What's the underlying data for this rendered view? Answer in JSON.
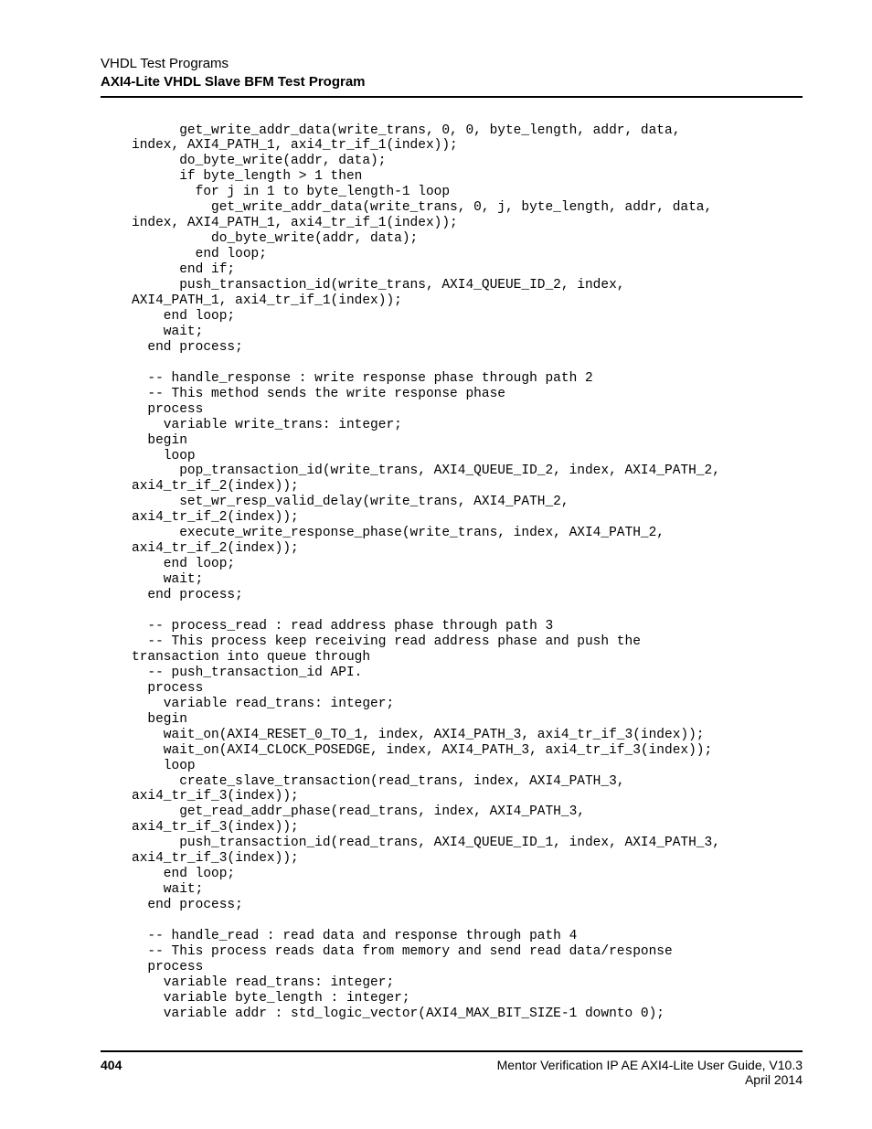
{
  "header": {
    "line1": "VHDL Test Programs",
    "line2": "AXI4-Lite VHDL Slave BFM Test Program"
  },
  "code": "      get_write_addr_data(write_trans, 0, 0, byte_length, addr, data,\nindex, AXI4_PATH_1, axi4_tr_if_1(index));\n      do_byte_write(addr, data);\n      if byte_length > 1 then\n        for j in 1 to byte_length-1 loop\n          get_write_addr_data(write_trans, 0, j, byte_length, addr, data,\nindex, AXI4_PATH_1, axi4_tr_if_1(index));\n          do_byte_write(addr, data);\n        end loop;\n      end if;\n      push_transaction_id(write_trans, AXI4_QUEUE_ID_2, index,\nAXI4_PATH_1, axi4_tr_if_1(index));\n    end loop;\n    wait;\n  end process;\n\n  -- handle_response : write response phase through path 2\n  -- This method sends the write response phase\n  process\n    variable write_trans: integer;\n  begin\n    loop\n      pop_transaction_id(write_trans, AXI4_QUEUE_ID_2, index, AXI4_PATH_2,\naxi4_tr_if_2(index));\n      set_wr_resp_valid_delay(write_trans, AXI4_PATH_2,\naxi4_tr_if_2(index));\n      execute_write_response_phase(write_trans, index, AXI4_PATH_2,\naxi4_tr_if_2(index));\n    end loop;\n    wait;\n  end process;\n\n  -- process_read : read address phase through path 3\n  -- This process keep receiving read address phase and push the\ntransaction into queue through\n  -- push_transaction_id API.\n  process\n    variable read_trans: integer;\n  begin\n    wait_on(AXI4_RESET_0_TO_1, index, AXI4_PATH_3, axi4_tr_if_3(index));\n    wait_on(AXI4_CLOCK_POSEDGE, index, AXI4_PATH_3, axi4_tr_if_3(index));\n    loop\n      create_slave_transaction(read_trans, index, AXI4_PATH_3,\naxi4_tr_if_3(index));\n      get_read_addr_phase(read_trans, index, AXI4_PATH_3,\naxi4_tr_if_3(index));\n      push_transaction_id(read_trans, AXI4_QUEUE_ID_1, index, AXI4_PATH_3,\naxi4_tr_if_3(index));\n    end loop;\n    wait;\n  end process;\n\n  -- handle_read : read data and response through path 4\n  -- This process reads data from memory and send read data/response\n  process\n    variable read_trans: integer;\n    variable byte_length : integer;\n    variable addr : std_logic_vector(AXI4_MAX_BIT_SIZE-1 downto 0);",
  "footer": {
    "page": "404",
    "guide": "Mentor Verification IP AE AXI4-Lite User Guide, V10.3",
    "date": "April 2014"
  }
}
